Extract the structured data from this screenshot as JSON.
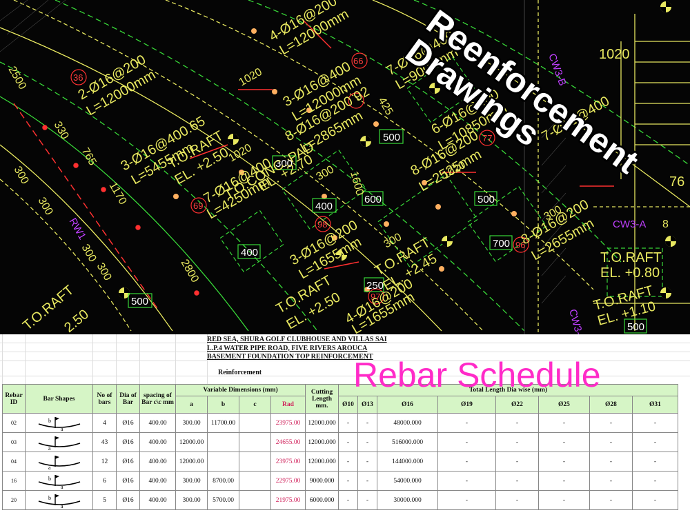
{
  "overlay": {
    "drawings_title": "Reenforcement Drawings",
    "schedule_title": "Rebar Schedule"
  },
  "cad": {
    "labels": [
      "4-Ø16@200",
      "L=12000mm",
      "2-Ø16@200",
      "L=12000mm",
      "36",
      "3-Ø16@400",
      "L=12000mm",
      "66",
      "7-Ø16@400",
      "L=9000mm",
      "3-Ø16@400.65",
      "L=5455mm",
      "8-Ø16@200 92",
      "L=2865mm",
      "T.O.RAFT",
      "EL. +2.50",
      "7-Ø16@400",
      "L=4250mm",
      "69",
      "T.O.CONC. PAD",
      "EL. +2.70",
      "8-Ø16@200",
      "L=2525mm",
      "77",
      "6-Ø16@400",
      "L=10850mm",
      "7-Ø16@400",
      "3-Ø16@200",
      "L=1655mm",
      "98",
      "T.O.RAFT",
      "EL. +2.45",
      "T.O.RAFT",
      "EL. +2.50",
      "8-Ø16@200",
      "L=2655mm",
      "96",
      "T.O.RAFT",
      "EL. +0.80",
      "T.O.RAFT",
      "EL. +1.10",
      "T.O.RAFT",
      "2.50",
      "97",
      "4-Ø16@200",
      "L=1655mm"
    ],
    "dims": [
      "2500",
      "330",
      "765",
      "1170",
      "1020",
      "1020",
      "1020",
      "1020",
      "1600",
      "2800",
      "300",
      "300",
      "300",
      "300",
      "300",
      "300",
      "300",
      "76",
      "425",
      "8"
    ],
    "boxes": [
      "500",
      "300",
      "400",
      "600",
      "500",
      "700",
      "400",
      "250",
      "500",
      "500"
    ],
    "tags": [
      "RW1",
      "CW3-B",
      "CW3-A",
      "CW3-C"
    ]
  },
  "sheet": {
    "header_lines": [
      "RED SEA, SHURA GOLF CLUBHOUSE AND VILLAS SAI",
      "L.P.4 WATER PIPE ROAD, FIVE RIVERS AROUCA",
      "BASEMENT FOUNDATION TOP REINFORCEMENT"
    ],
    "section_label": "Reinforcement",
    "columns": {
      "rebar_id": "Rebar ID",
      "bar_shapes": "Bar Shapes",
      "no_of_bars": "No of bars",
      "dia_of_bar": "Dia of Bar",
      "spacing": "spacing of Bar c\\c mm",
      "variable_dims": "Variable Dimensions (mm)",
      "a": "a",
      "b": "b",
      "c": "c",
      "rad": "Rad",
      "cutting_length": "Cutting Length mm.",
      "total_length": "Total Length Dia wise (mm)",
      "d10": "Ø10",
      "d13": "Ø13",
      "d16": "Ø16",
      "d19": "Ø19",
      "d22": "Ø22",
      "d25": "Ø25",
      "d28": "Ø28",
      "d31": "Ø31"
    },
    "rows": [
      {
        "id": "02",
        "shape": "abc",
        "bars": "4",
        "dia": "Ø16",
        "spacing": "400.00",
        "a": "300.00",
        "b": "11700.00",
        "c": "",
        "rad": "23975.00",
        "cut": "12000.000",
        "d10": "-",
        "d13": "-",
        "d16": "48000.000",
        "d19": "-",
        "d22": "-",
        "d25": "-",
        "d28": "-",
        "d31": "-"
      },
      {
        "id": "03",
        "shape": "a",
        "bars": "43",
        "dia": "Ø16",
        "spacing": "400.00",
        "a": "12000.00",
        "b": "",
        "c": "",
        "rad": "24655.00",
        "cut": "12000.000",
        "d10": "-",
        "d13": "-",
        "d16": "516000.000",
        "d19": "-",
        "d22": "-",
        "d25": "-",
        "d28": "-",
        "d31": "-"
      },
      {
        "id": "04",
        "shape": "a",
        "bars": "12",
        "dia": "Ø16",
        "spacing": "400.00",
        "a": "12000.00",
        "b": "",
        "c": "",
        "rad": "23975.00",
        "cut": "12000.000",
        "d10": "-",
        "d13": "-",
        "d16": "144000.000",
        "d19": "-",
        "d22": "-",
        "d25": "-",
        "d28": "-",
        "d31": "-"
      },
      {
        "id": "16",
        "shape": "abc",
        "bars": "6",
        "dia": "Ø16",
        "spacing": "400.00",
        "a": "300.00",
        "b": "8700.00",
        "c": "",
        "rad": "22975.00",
        "cut": "9000.000",
        "d10": "-",
        "d13": "-",
        "d16": "54000.000",
        "d19": "-",
        "d22": "-",
        "d25": "-",
        "d28": "-",
        "d31": "-"
      },
      {
        "id": "20",
        "shape": "abc",
        "bars": "5",
        "dia": "Ø16",
        "spacing": "400.00",
        "a": "300.00",
        "b": "5700.00",
        "c": "",
        "rad": "21975.00",
        "cut": "6000.000",
        "d10": "-",
        "d13": "-",
        "d16": "30000.000",
        "d19": "-",
        "d22": "-",
        "d25": "-",
        "d28": "-",
        "d31": "-"
      }
    ]
  }
}
